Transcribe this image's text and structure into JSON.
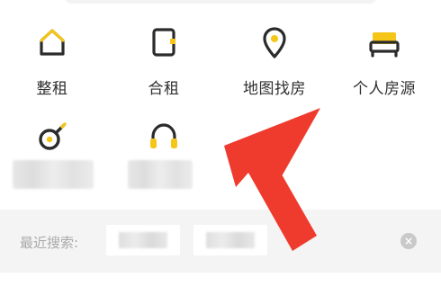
{
  "tiles": [
    {
      "label": "整租",
      "icon": "house-icon"
    },
    {
      "label": "合租",
      "icon": "room-door-icon"
    },
    {
      "label": "地图找房",
      "icon": "map-pin-icon"
    },
    {
      "label": "个人房源",
      "icon": "bed-icon"
    },
    {
      "label": "",
      "icon": "frying-pan-icon"
    },
    {
      "label": "",
      "icon": "headphones-icon"
    }
  ],
  "recent": {
    "label": "最近搜索:",
    "clear_icon": "clear-circle-icon"
  },
  "colors": {
    "accent_yellow": "#f5c518",
    "icon_dark": "#2b2b2b",
    "arrow_red": "#ef3b2d"
  }
}
